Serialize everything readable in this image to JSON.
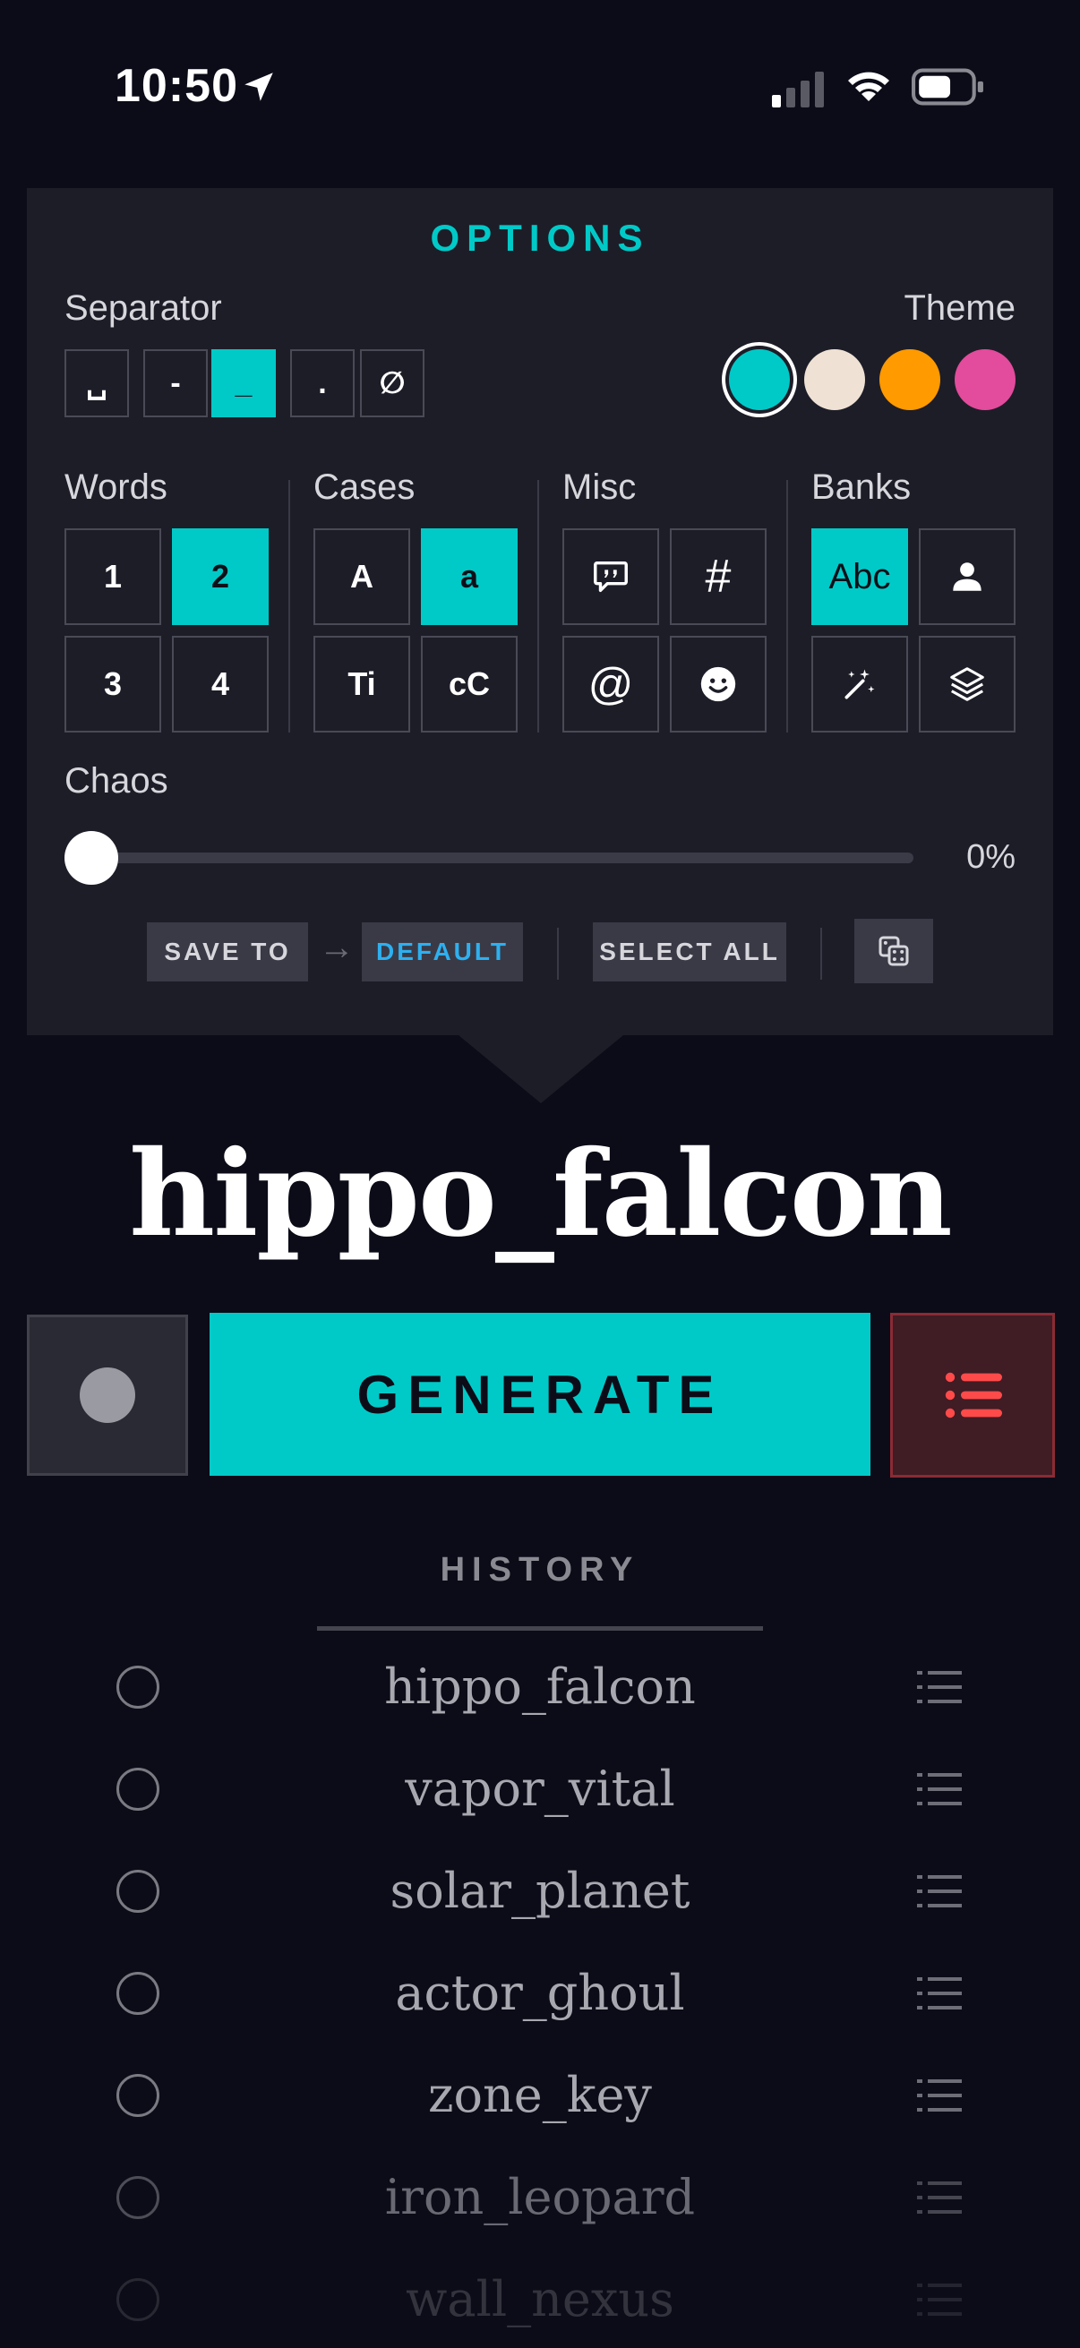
{
  "status": {
    "time": "10:50"
  },
  "options": {
    "title": "OPTIONS",
    "separator": {
      "label": "Separator",
      "buttons": [
        "␣",
        "-",
        "_",
        ".",
        "∅"
      ],
      "active": "_"
    },
    "theme": {
      "label": "Theme",
      "colors": [
        "#00cac8",
        "#efe2d4",
        "#ff9a00",
        "#e34b9c"
      ],
      "selected": "#00cac8"
    },
    "words": {
      "label": "Words",
      "buttons": [
        "1",
        "2",
        "3",
        "4"
      ],
      "active": "2"
    },
    "cases": {
      "label": "Cases",
      "buttons": [
        "A",
        "a",
        "Ti",
        "cC"
      ],
      "active": "a"
    },
    "misc": {
      "label": "Misc",
      "icons": [
        "quote-bubble-icon",
        "hash-icon",
        "at-icon",
        "smiley-icon"
      ],
      "glyphs": {
        "hash": "#",
        "at": "@"
      }
    },
    "banks": {
      "label": "Banks",
      "buttons": [
        "Abc",
        "person-icon",
        "magic-wand-icon",
        "layers-icon"
      ],
      "active": "Abc"
    },
    "chaos": {
      "label": "Chaos",
      "value": "0%",
      "fraction": 0.0
    },
    "actions": {
      "save_to": "SAVE TO",
      "default": "DEFAULT",
      "select_all": "SELECT ALL",
      "dice_icon": "dice-icon"
    }
  },
  "result": "hippo_falcon",
  "generate": {
    "label": "GENERATE"
  },
  "history": {
    "title": "HISTORY",
    "items": [
      "hippo_falcon",
      "vapor_vital",
      "solar_planet",
      "actor_ghoul",
      "zone_key",
      "iron_leopard",
      "wall_nexus"
    ]
  }
}
